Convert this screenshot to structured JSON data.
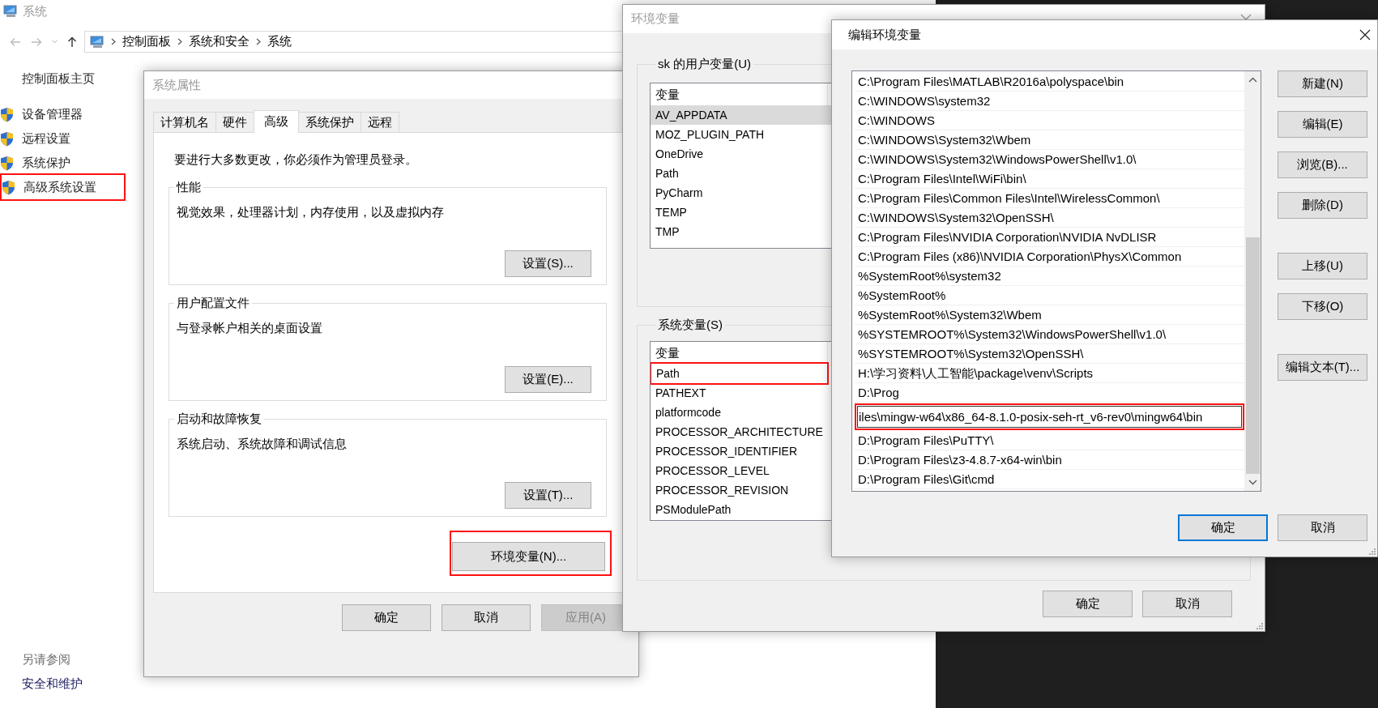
{
  "system_window": {
    "title": "系统",
    "breadcrumb": [
      "控制面板",
      "系统和安全",
      "系统"
    ],
    "sidebar": {
      "home": "控制面板主页",
      "items": [
        {
          "label": "设备管理器",
          "highlighted": false
        },
        {
          "label": "远程设置",
          "highlighted": false
        },
        {
          "label": "系统保护",
          "highlighted": false
        },
        {
          "label": "高级系统设置",
          "highlighted": true
        }
      ]
    },
    "see_also": {
      "heading": "另请参阅",
      "links": [
        "安全和维护"
      ]
    }
  },
  "system_properties": {
    "title": "系统属性",
    "tabs": [
      {
        "label": "计算机名",
        "selected": false
      },
      {
        "label": "硬件",
        "selected": false
      },
      {
        "label": "高级",
        "selected": true
      },
      {
        "label": "系统保护",
        "selected": false
      },
      {
        "label": "远程",
        "selected": false
      }
    ],
    "notice": "要进行大多数更改，你必须作为管理员登录。",
    "groups": [
      {
        "title": "性能",
        "description": "视觉效果，处理器计划，内存使用，以及虚拟内存",
        "button": "设置(S)..."
      },
      {
        "title": "用户配置文件",
        "description": "与登录帐户相关的桌面设置",
        "button": "设置(E)..."
      },
      {
        "title": "启动和故障恢复",
        "description": "系统启动、系统故障和调试信息",
        "button": "设置(T)..."
      }
    ],
    "env_button": {
      "label": "环境变量(N)...",
      "highlighted": true
    },
    "buttons": [
      {
        "label": "确定",
        "disabled": false
      },
      {
        "label": "取消",
        "disabled": false
      },
      {
        "label": "应用(A)",
        "disabled": true
      }
    ]
  },
  "environment_variables": {
    "title": "环境变量",
    "user_group": {
      "title": "sk 的用户变量(U)",
      "column": "变量",
      "rows": [
        {
          "name": "AV_APPDATA",
          "selected": true,
          "highlighted": false
        },
        {
          "name": "MOZ_PLUGIN_PATH",
          "selected": false,
          "highlighted": false
        },
        {
          "name": "OneDrive",
          "selected": false,
          "highlighted": false
        },
        {
          "name": "Path",
          "selected": false,
          "highlighted": false
        },
        {
          "name": "PyCharm",
          "selected": false,
          "highlighted": false
        },
        {
          "name": "TEMP",
          "selected": false,
          "highlighted": false
        },
        {
          "name": "TMP",
          "selected": false,
          "highlighted": false
        }
      ]
    },
    "system_group": {
      "title": "系统变量(S)",
      "column": "变量",
      "rows": [
        {
          "name": "Path",
          "selected": false,
          "highlighted": true
        },
        {
          "name": "PATHEXT",
          "selected": false,
          "highlighted": false
        },
        {
          "name": "platformcode",
          "selected": false,
          "highlighted": false
        },
        {
          "name": "PROCESSOR_ARCHITECTURE",
          "selected": false,
          "highlighted": false
        },
        {
          "name": "PROCESSOR_IDENTIFIER",
          "selected": false,
          "highlighted": false
        },
        {
          "name": "PROCESSOR_LEVEL",
          "selected": false,
          "highlighted": false
        },
        {
          "name": "PROCESSOR_REVISION",
          "selected": false,
          "highlighted": false
        },
        {
          "name": "PSModulePath",
          "selected": false,
          "highlighted": false
        }
      ]
    },
    "buttons": [
      "确定",
      "取消"
    ]
  },
  "edit_variable": {
    "title": "编辑环境变量",
    "entries": [
      {
        "kind": "path",
        "text": "C:\\Program Files\\MATLAB\\R2016a\\polyspace\\bin",
        "highlighted": false
      },
      {
        "kind": "path",
        "text": "C:\\WINDOWS\\system32",
        "highlighted": false
      },
      {
        "kind": "path",
        "text": "C:\\WINDOWS",
        "highlighted": false
      },
      {
        "kind": "path",
        "text": "C:\\WINDOWS\\System32\\Wbem",
        "highlighted": false
      },
      {
        "kind": "path",
        "text": "C:\\WINDOWS\\System32\\WindowsPowerShell\\v1.0\\",
        "highlighted": false
      },
      {
        "kind": "path",
        "text": "C:\\Program Files\\Intel\\WiFi\\bin\\",
        "highlighted": false
      },
      {
        "kind": "path",
        "text": "C:\\Program Files\\Common Files\\Intel\\WirelessCommon\\",
        "highlighted": false
      },
      {
        "kind": "path",
        "text": "C:\\WINDOWS\\System32\\OpenSSH\\",
        "highlighted": false
      },
      {
        "kind": "path",
        "text": "C:\\Program Files\\NVIDIA Corporation\\NVIDIA NvDLISR",
        "highlighted": false
      },
      {
        "kind": "path",
        "text": "C:\\Program Files (x86)\\NVIDIA Corporation\\PhysX\\Common",
        "highlighted": false
      },
      {
        "kind": "path",
        "text": "%SystemRoot%\\system32",
        "highlighted": false
      },
      {
        "kind": "path",
        "text": "%SystemRoot%",
        "highlighted": false
      },
      {
        "kind": "path",
        "text": "%SystemRoot%\\System32\\Wbem",
        "highlighted": false
      },
      {
        "kind": "path",
        "text": "%SYSTEMROOT%\\System32\\WindowsPowerShell\\v1.0\\",
        "highlighted": false
      },
      {
        "kind": "path",
        "text": "%SYSTEMROOT%\\System32\\OpenSSH\\",
        "highlighted": false
      },
      {
        "kind": "path",
        "text": "H:\\学习资料\\人工智能\\package\\venv\\Scripts",
        "highlighted": false
      },
      {
        "kind": "path",
        "text": "D:\\Prog",
        "highlighted": false
      },
      {
        "kind": "editing",
        "value": "iles\\mingw-w64\\x86_64-8.1.0-posix-seh-rt_v6-rev0\\mingw64\\bin",
        "highlighted": true
      },
      {
        "kind": "path",
        "text": "D:\\Program Files\\PuTTY\\",
        "highlighted": false
      },
      {
        "kind": "path",
        "text": "D:\\Program Files\\z3-4.8.7-x64-win\\bin",
        "highlighted": false
      },
      {
        "kind": "path",
        "text": "D:\\Program Files\\Git\\cmd",
        "highlighted": false
      }
    ],
    "side_button_groups": [
      [
        "新建(N)",
        "编辑(E)",
        "浏览(B)...",
        "删除(D)"
      ],
      [
        "上移(U)",
        "下移(O)"
      ],
      [
        "编辑文本(T)..."
      ]
    ],
    "buttons": [
      {
        "label": "确定",
        "default": true
      },
      {
        "label": "取消",
        "default": false
      }
    ]
  }
}
